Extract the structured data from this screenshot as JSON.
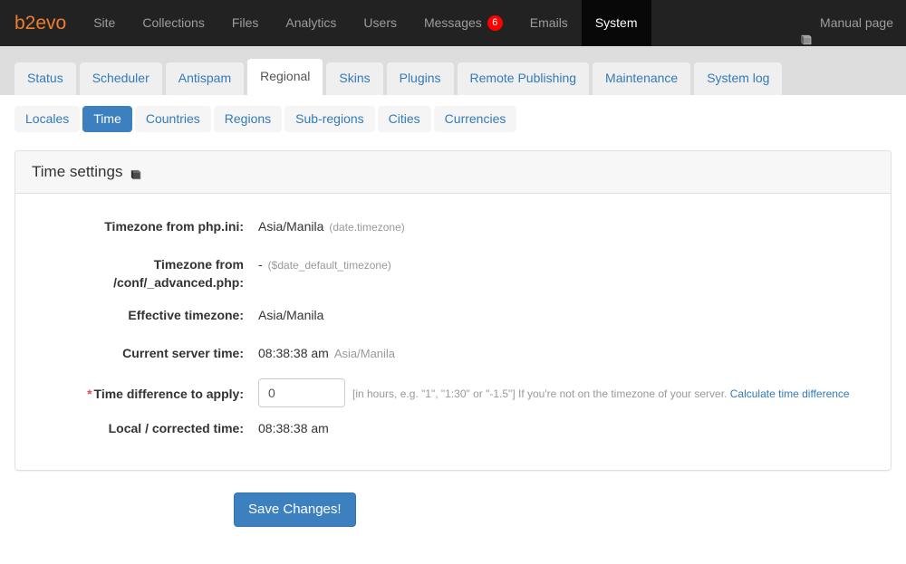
{
  "navbar": {
    "brand": "b2evo",
    "items": [
      {
        "label": "Site",
        "active": false
      },
      {
        "label": "Collections",
        "active": false
      },
      {
        "label": "Files",
        "active": false
      },
      {
        "label": "Analytics",
        "active": false
      },
      {
        "label": "Users",
        "active": false
      },
      {
        "label": "Messages",
        "active": false,
        "badge": "6"
      },
      {
        "label": "Emails",
        "active": false
      },
      {
        "label": "System",
        "active": true
      }
    ],
    "manual_label": "Manual page",
    "manual_icon": "book-icon",
    "badge_color": "#ff0000",
    "brand_color": "#ed7d2f",
    "background": "#222222",
    "active_background": "#080808"
  },
  "tabs": {
    "items": [
      {
        "label": "Status",
        "active": false
      },
      {
        "label": "Scheduler",
        "active": false
      },
      {
        "label": "Antispam",
        "active": false
      },
      {
        "label": "Regional",
        "active": true
      },
      {
        "label": "Skins",
        "active": false
      },
      {
        "label": "Plugins",
        "active": false
      },
      {
        "label": "Remote Publishing",
        "active": false
      },
      {
        "label": "Maintenance",
        "active": false
      },
      {
        "label": "System log",
        "active": false
      }
    ]
  },
  "subtabs": {
    "items": [
      {
        "label": "Locales",
        "active": false
      },
      {
        "label": "Time",
        "active": true
      },
      {
        "label": "Countries",
        "active": false
      },
      {
        "label": "Regions",
        "active": false
      },
      {
        "label": "Sub-regions",
        "active": false
      },
      {
        "label": "Cities",
        "active": false
      },
      {
        "label": "Currencies",
        "active": false
      }
    ],
    "active_color": "#3c80c0"
  },
  "panel": {
    "title": "Time settings",
    "title_icon": "book-icon",
    "rows": {
      "php_ini": {
        "label": "Timezone from php.ini:",
        "value": "Asia/Manila",
        "note": "(date.timezone)"
      },
      "conf_advanced": {
        "label": "Timezone from /conf/_advanced.php:",
        "label_line1": "Timezone from",
        "label_line2": "/conf/_advanced.php:",
        "value": "-",
        "note": "($date_default_timezone)"
      },
      "effective": {
        "label": "Effective timezone:",
        "value": "Asia/Manila"
      },
      "server_time": {
        "label": "Current server time:",
        "value": "08:38:38 am",
        "note": "Asia/Manila"
      },
      "time_difference": {
        "required_marker": "*",
        "label": "Time difference to apply:",
        "input_value": "0",
        "help": "[in hours, e.g. \"1\", \"1:30\" or \"-1.5\"] If you're not on the timezone of your server.",
        "link": "Calculate time difference"
      },
      "local_time": {
        "label": "Local / corrected time:",
        "value": "08:38:38 am"
      }
    }
  },
  "footer": {
    "save_label": "Save Changes!",
    "save_color": "#3c80c0"
  }
}
